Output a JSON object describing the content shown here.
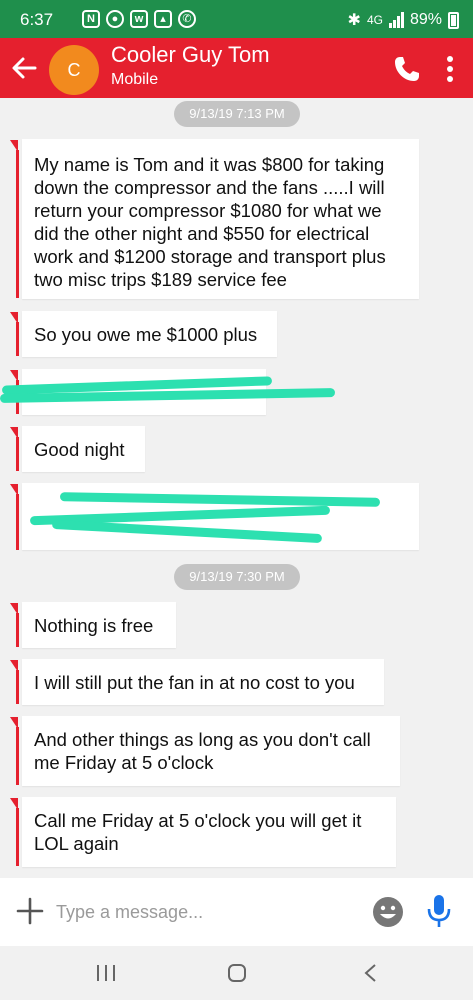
{
  "status_bar": {
    "time": "6:37",
    "network": "4G",
    "network_sub": "LTE",
    "battery": "89%"
  },
  "header": {
    "avatar_initial": "C",
    "contact_name": "Cooler Guy Tom",
    "contact_sub": "Mobile"
  },
  "colors": {
    "app_bar": "#e5202e",
    "status_bar": "#1f8f4c",
    "avatar": "#f28a1e",
    "redaction": "#2de0b0",
    "accent_mic": "#1a73e8"
  },
  "timestamps": [
    "9/13/19 7:13 PM",
    "9/13/19 7:30 PM"
  ],
  "messages": [
    {
      "text": "My name is Tom and it was $800 for taking down the compressor and the fans .....I will return your compressor $1080 for what we did the other night and $550 for electrical work and $1200 storage and transport plus two misc trips $189 service fee"
    },
    {
      "text": "So you owe me $1000 plus"
    },
    {
      "text": "",
      "redacted": true
    },
    {
      "text": "Good night"
    },
    {
      "text": "",
      "redacted": true
    },
    {
      "text": "Nothing is free"
    },
    {
      "text": "I will still put the fan in at no cost to you"
    },
    {
      "text": "And other things as long as you don't call me Friday at 5 o'clock"
    },
    {
      "text": "Call me Friday at 5 o'clock you will get it LOL again"
    }
  ],
  "compose": {
    "placeholder": "Type a message..."
  },
  "icons": {
    "back": "arrow-left-icon",
    "call": "phone-icon",
    "more": "more-vert-icon",
    "attach": "plus-icon",
    "emoji": "smiley-icon",
    "mic": "microphone-icon",
    "nav_recents": "recents-icon",
    "nav_home": "home-icon",
    "nav_back": "chevron-left-icon"
  }
}
